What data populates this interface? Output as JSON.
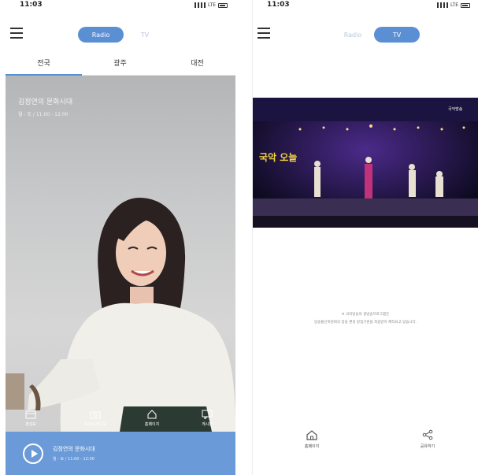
{
  "left": {
    "status": {
      "time": "11:03",
      "network": "LTE"
    },
    "segment": {
      "radio": "Radio",
      "tv": "TV"
    },
    "tabs": [
      {
        "label": "전국"
      },
      {
        "label": "광주"
      },
      {
        "label": "대전"
      }
    ],
    "hero": {
      "program_title": "김정연의 문화시대",
      "air_time": "월 - 토 / 11:00 - 12:00"
    },
    "actions": [
      {
        "label": "편성표"
      },
      {
        "label": "보이는라디오"
      },
      {
        "label": "홈페이지"
      },
      {
        "label": "게시판"
      }
    ],
    "player": {
      "title": "김정연의 문화시대",
      "time": "월 - 토 / 11:00 - 12:00"
    }
  },
  "right": {
    "status": {
      "time": "11:03",
      "network": "LTE"
    },
    "segment": {
      "radio": "Radio",
      "tv": "TV"
    },
    "video": {
      "logo_text": "국악방송",
      "title_script": "국악 오늘"
    },
    "notice": {
      "line1": "※ 국악방송의 생방송프로그램은",
      "line2": "방송통신위원회의 방송 편성 방침기준을 적용받아 제작되고 있습니다."
    },
    "actions": [
      {
        "label": "홈페이지"
      },
      {
        "label": "공유하기"
      }
    ]
  },
  "colors": {
    "accent": "#5b8fd4",
    "player_bar": "#6a9bd8"
  }
}
